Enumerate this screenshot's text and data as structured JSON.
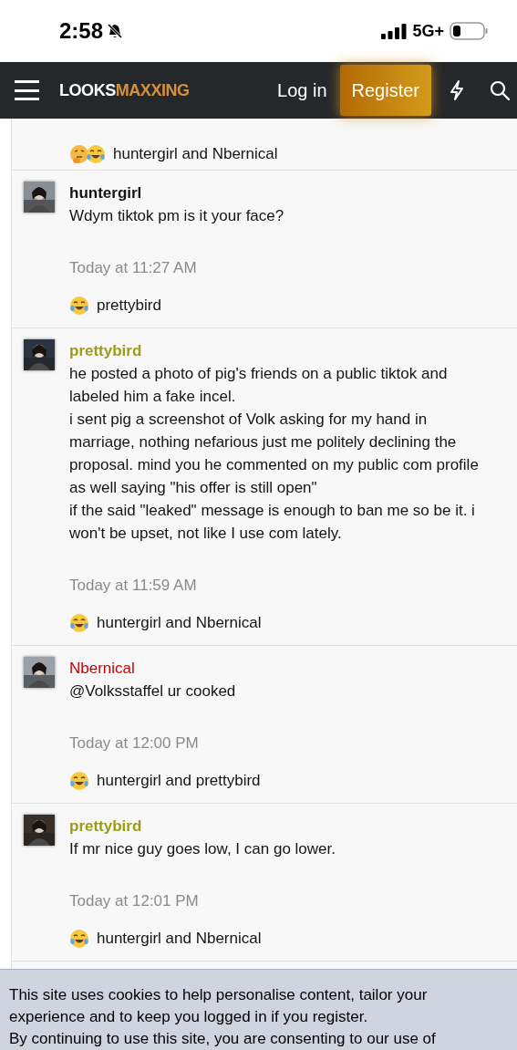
{
  "status_bar": {
    "time": "2:58",
    "network": "5G+"
  },
  "header": {
    "logo": [
      "LOOKS",
      "MAXXING"
    ],
    "login": "Log in",
    "register": "Register"
  },
  "posts": [
    {
      "kind": "partial",
      "reactions": {
        "emojis": [
          {
            "kind": "thinking"
          },
          {
            "kind": "laughing"
          }
        ],
        "text": "huntergirl and Nbernical"
      }
    },
    {
      "kind": "full",
      "author": "huntergirl",
      "author_bold": true,
      "color": "#141414",
      "lines": [
        "Wdym tiktok pm is it your face?"
      ],
      "time": "Today at 11:27 AM",
      "reactions": {
        "emojis": [
          {
            "kind": "laughing"
          }
        ],
        "text": "prettybird"
      }
    },
    {
      "kind": "full",
      "author": "prettybird",
      "author_bold": true,
      "color": "#9c9c16",
      "lines": [
        "he posted a photo of pig's friends on a public tiktok and labeled him a fake incel.",
        "i sent pig a screenshot of Volk asking for my hand in marriage, nothing nefarious just me politely declining the proposal. mind you he commented on my public com profile as well saying \"his offer is still open\"",
        "if the said \"leaked\" message is enough to ban me so be it. i won't be upset, not like I use com lately."
      ],
      "time": "Today at 11:59 AM",
      "reactions": {
        "emojis": [
          {
            "kind": "laughing"
          }
        ],
        "text": "huntergirl and Nbernical"
      }
    },
    {
      "kind": "full",
      "author": "Nbernical",
      "author_bold": false,
      "color": "#cc0000",
      "lines": [
        "@Volksstaffel ur cooked"
      ],
      "time": "Today at 12:00 PM",
      "reactions": {
        "emojis": [
          {
            "kind": "laughing"
          }
        ],
        "text": "huntergirl and prettybird"
      }
    },
    {
      "kind": "full",
      "author": "prettybird",
      "author_bold": true,
      "color": "#9c9c16",
      "lines": [
        "If mr nice guy goes low, I can go lower."
      ],
      "time": "Today at 12:01 PM",
      "reactions": {
        "emojis": [
          {
            "kind": "laughing"
          }
        ],
        "text": "huntergirl and Nbernical"
      }
    }
  ],
  "cookie_notice": [
    "This site uses cookies to help personalise content, tailor your experience and to keep you logged in if you register.",
    "By continuing to use this site, you are consenting to our use of"
  ]
}
